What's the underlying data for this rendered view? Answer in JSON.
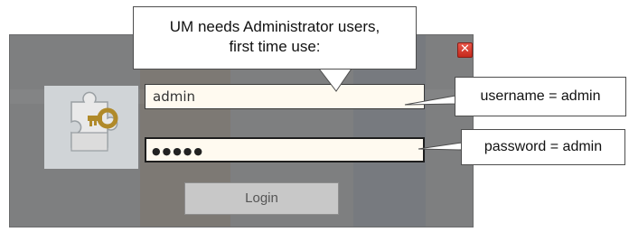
{
  "window": {
    "close_glyph": "✕"
  },
  "login": {
    "username_value": "admin",
    "password_mask": "●●●●●",
    "login_label": "Login"
  },
  "annotations": {
    "top_line1": "UM needs Administrator users,",
    "top_line2": "first time use:",
    "username_note": "username = admin",
    "password_note": "password = admin"
  },
  "icons": {
    "close": "close-icon",
    "logo": "puzzle-key-icon"
  },
  "colors": {
    "window_bg": "#7e7f80",
    "field_bg": "#fffaf0",
    "close_red": "#d93a2e",
    "button_bg": "#c8c8c8"
  }
}
